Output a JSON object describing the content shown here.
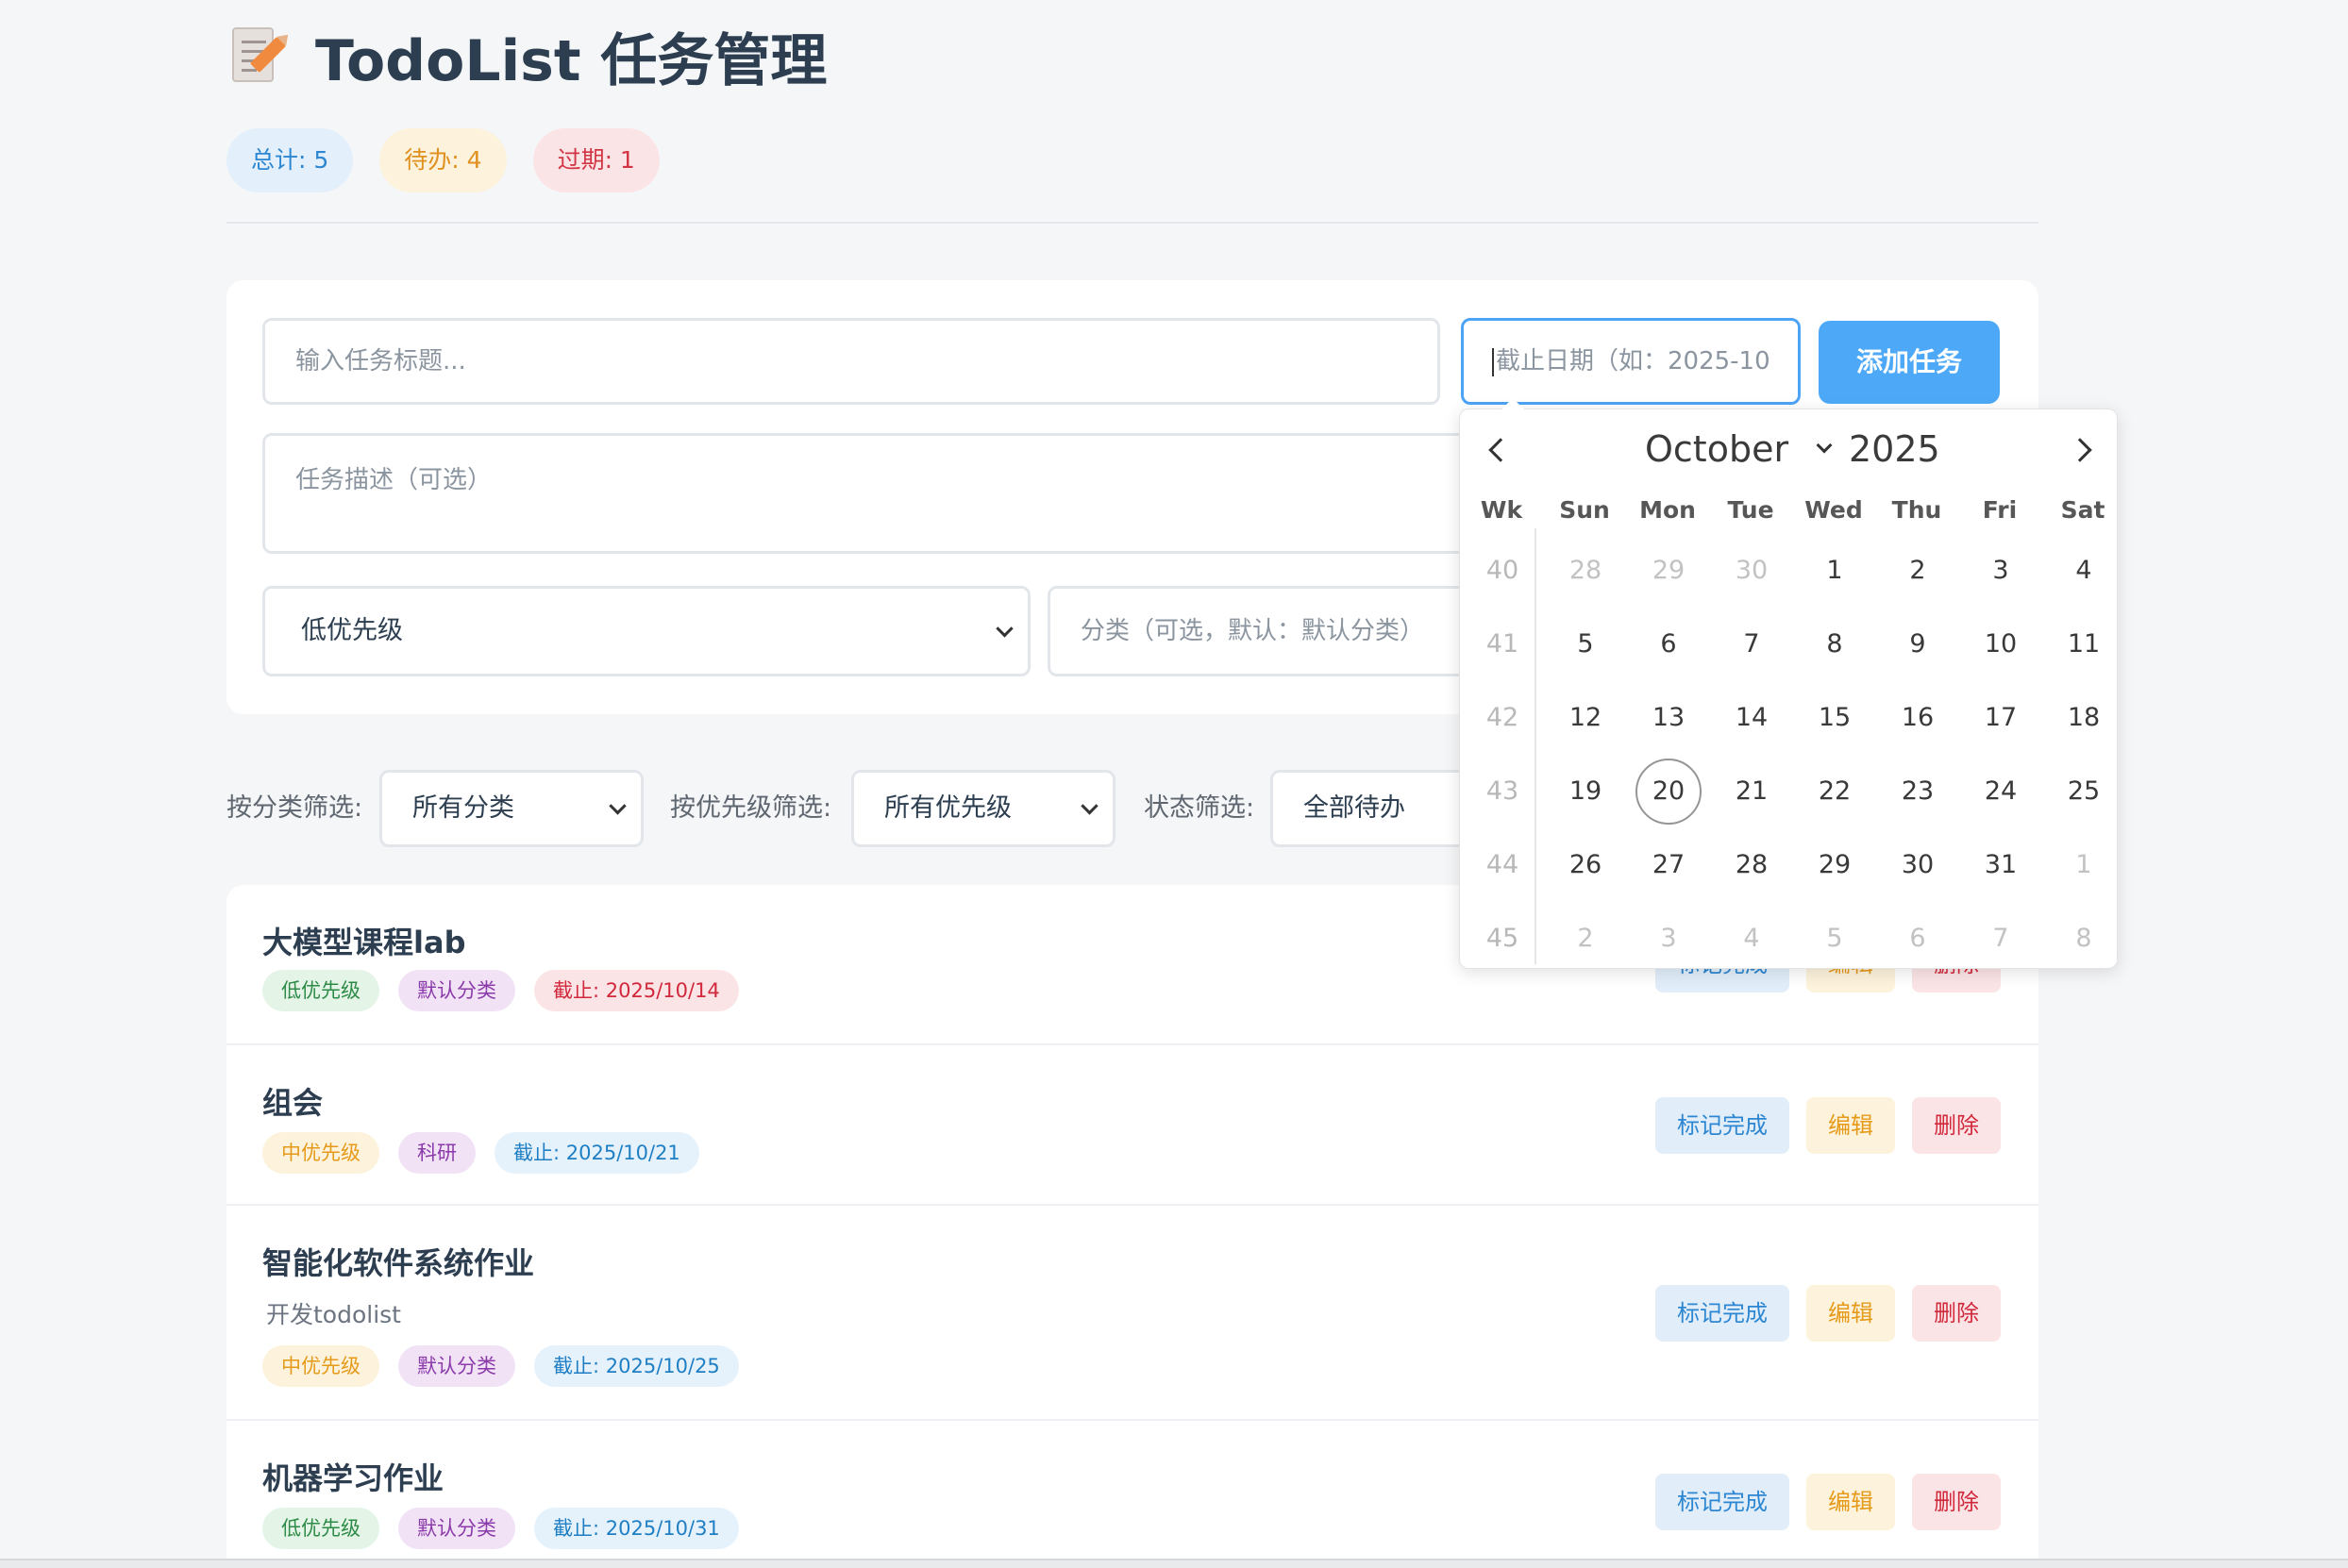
{
  "header": {
    "title": "TodoList 任务管理",
    "stats": {
      "total": "总计: 5",
      "pending": "待办: 4",
      "overdue": "过期: 1"
    }
  },
  "form": {
    "title_placeholder": "输入任务标题...",
    "date_placeholder": "截止日期（如：2025-10",
    "add_button": "添加任务",
    "desc_placeholder": "任务描述（可选）",
    "priority_value": "低优先级",
    "category_placeholder": "分类（可选，默认：默认分类）"
  },
  "filters": {
    "category_label": "按分类筛选:",
    "category_value": "所有分类",
    "priority_label": "按优先级筛选:",
    "priority_value": "所有优先级",
    "status_label": "状态筛选:",
    "status_value": "全部待办"
  },
  "tasks": [
    {
      "title": "大模型课程lab",
      "desc": "",
      "priority": "低优先级",
      "category": "默认分类",
      "due": "截止: 2025/10/14"
    },
    {
      "title": "组会",
      "desc": "",
      "priority": "中优先级",
      "category": "科研",
      "due": "截止: 2025/10/21"
    },
    {
      "title": "智能化软件系统作业",
      "desc": "开发todolist",
      "priority": "中优先级",
      "category": "默认分类",
      "due": "截止: 2025/10/25"
    },
    {
      "title": "机器学习作业",
      "desc": "",
      "priority": "低优先级",
      "category": "默认分类",
      "due": "截止: 2025/10/31"
    }
  ],
  "task_actions": {
    "done": "标记完成",
    "edit": "编辑",
    "delete": "删除"
  },
  "datepicker": {
    "month": "October",
    "year": "2025",
    "headers": [
      "Wk",
      "Sun",
      "Mon",
      "Tue",
      "Wed",
      "Thu",
      "Fri",
      "Sat"
    ],
    "today": "20",
    "weeks": [
      {
        "wk": "40",
        "days": [
          "28",
          "29",
          "30",
          "1",
          "2",
          "3",
          "4"
        ]
      },
      {
        "wk": "41",
        "days": [
          "5",
          "6",
          "7",
          "8",
          "9",
          "10",
          "11"
        ]
      },
      {
        "wk": "42",
        "days": [
          "12",
          "13",
          "14",
          "15",
          "16",
          "17",
          "18"
        ]
      },
      {
        "wk": "43",
        "days": [
          "19",
          "20",
          "21",
          "22",
          "23",
          "24",
          "25"
        ]
      },
      {
        "wk": "44",
        "days": [
          "26",
          "27",
          "28",
          "29",
          "30",
          "31",
          "1"
        ]
      },
      {
        "wk": "45",
        "days": [
          "2",
          "3",
          "4",
          "5",
          "6",
          "7",
          "8"
        ]
      }
    ]
  }
}
